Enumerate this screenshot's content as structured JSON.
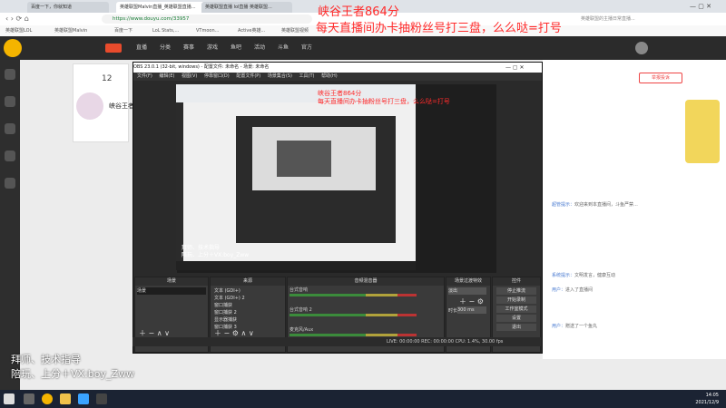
{
  "browser": {
    "tabs": [
      "百度一下，你就知道",
      "英雄联盟Malvin直播_英雄联盟直播...",
      "英雄联盟直播 lol直播 英雄联盟..."
    ],
    "url": "https://www.douyu.com/33957",
    "bookmarks": [
      "英雄联盟LOL",
      "英雄联盟Malvin",
      "百度一下",
      "LoL Stats,...",
      "VTmoon...",
      "Active英雄...",
      "英雄联盟视频"
    ],
    "search_hint": "英雄联盟的主播日常直播..."
  },
  "site": {
    "nav": [
      "直播",
      "分类",
      "赛事",
      "游戏",
      "鱼吧",
      "活动",
      "斗鱼",
      "官方"
    ],
    "fans_count": "12",
    "anchor_name": "峡谷王者",
    "report_label": "举报投诉",
    "chat": [
      {
        "user": "超管提示：",
        "text": "欢迎来到本直播间，斗鱼严禁..."
      },
      {
        "user": "系统提示：",
        "text": "文明发言，健康互动"
      },
      {
        "user": "用户：",
        "text": "进入了直播间"
      },
      {
        "user": "用户：",
        "text": "赠送了一个鱼丸"
      }
    ]
  },
  "overlay": {
    "title": "峡谷王者864分",
    "line": "每天直播间办卡抽粉丝号打三盘，么么哒=打号",
    "bottom1": "拜师、技术指导",
    "bottom2": "陪玩、上分＋VX:boy_Zww"
  },
  "obs": {
    "title": "OBS 23.0.1 (32-bit, windows) - 配置文件: 未命名 - 场景: 未命名",
    "menu": [
      "文件(F)",
      "编辑(E)",
      "视图(V)",
      "停靠窗口(D)",
      "配置文件(P)",
      "场景集合(S)",
      "工具(T)",
      "帮助(H)"
    ],
    "docks": {
      "scenes": "场景",
      "sources": "来源",
      "mixer": "音频混音器",
      "transitions": "场景过渡特效",
      "controls": "控件"
    },
    "scene_item": "场景",
    "sources": [
      "文本 (GDI+)",
      "文本 (GDI+) 2",
      "窗口捕获",
      "窗口捕获 2",
      "显示器捕获",
      "窗口捕获 3"
    ],
    "mixer": [
      "台式音响",
      "台式音响 2",
      "麦克风/Aux"
    ],
    "transition": "淡出",
    "duration_label": "时长",
    "duration": "300 ms",
    "controls": [
      "停止推流",
      "开始录制",
      "工作室模式",
      "设置",
      "退出"
    ],
    "status": "LIVE: 00:00:00   REC: 00:00:00   CPU: 1.4%, 30.00 fps"
  },
  "taskbar": {
    "time": "14:05",
    "date": "2021/12/9"
  }
}
